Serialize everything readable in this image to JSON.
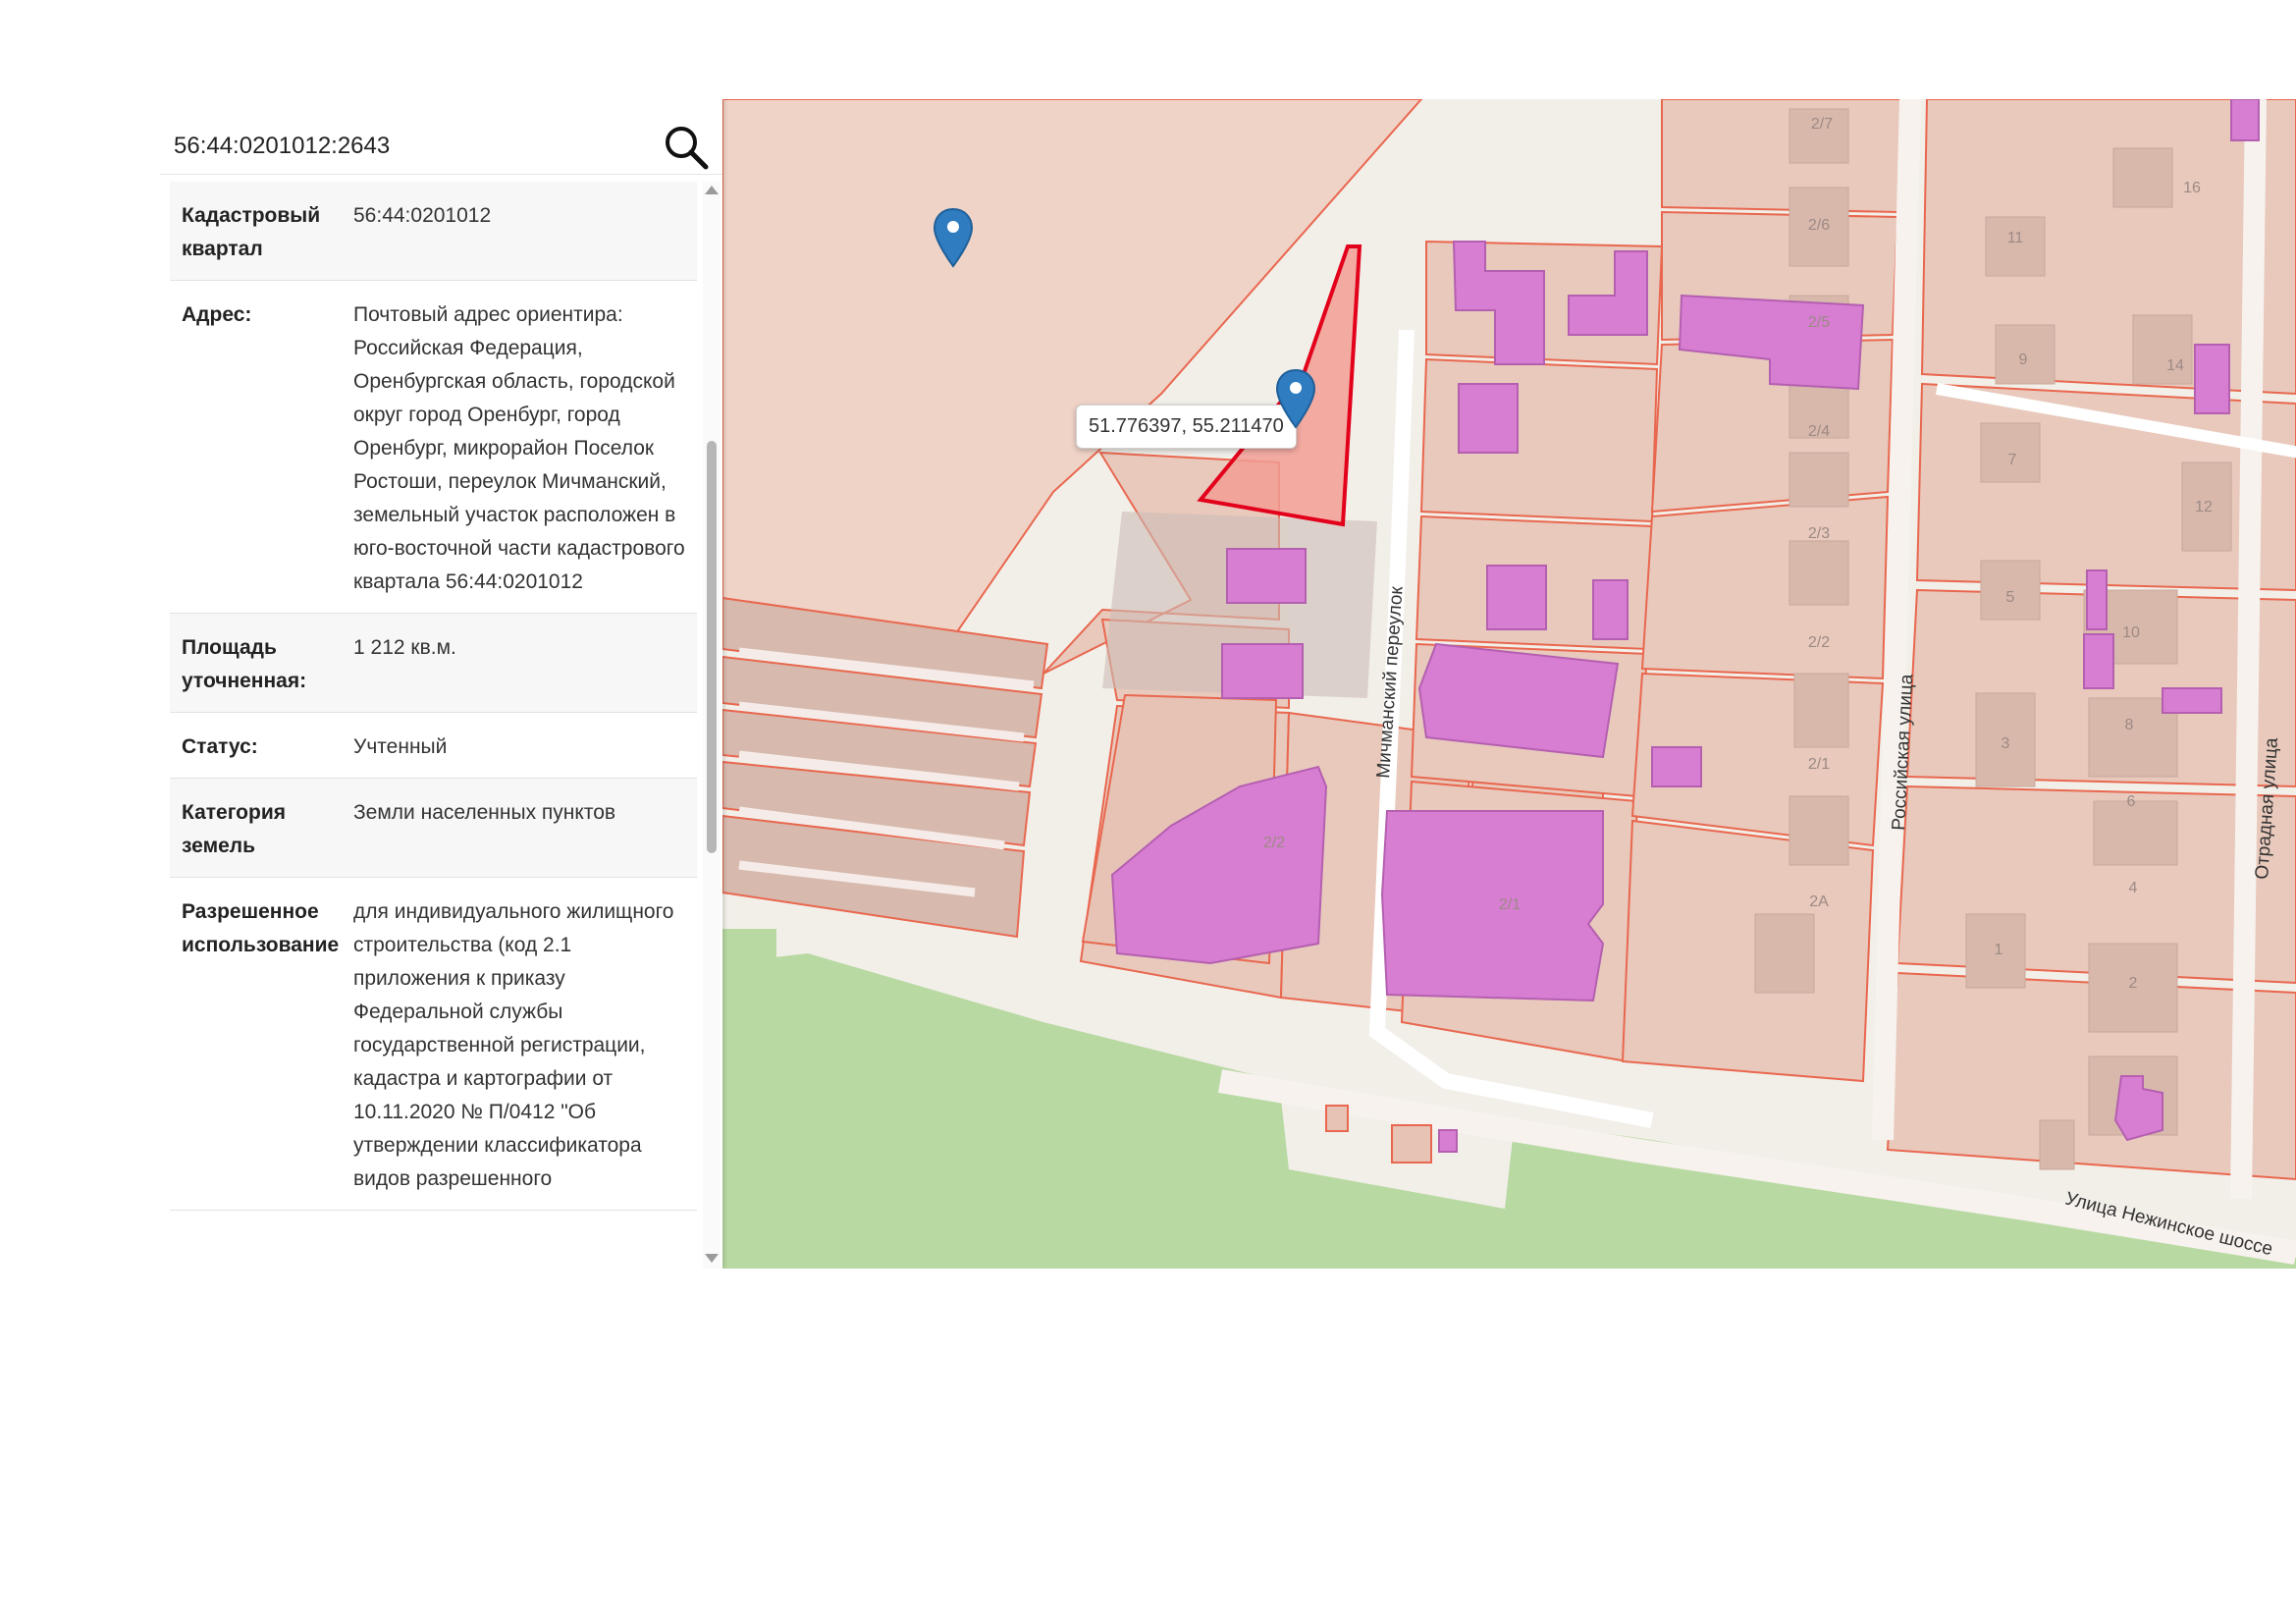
{
  "search": {
    "value": "56:44:0201012:2643",
    "button_icon": "search-icon"
  },
  "info_panel": {
    "rows": [
      {
        "label": "Кадастровый квартал",
        "value": "56:44:0201012"
      },
      {
        "label": "Адрес:",
        "value": "Почтовый адрес ориентира: Российская Федерация, Оренбургская область, городской округ город Оренбург, город Оренбург, микрорайон Поселок Ростоши, переулок Мичманский, земельный участок расположен в юго-восточной части кадастрового квартала 56:44:0201012"
      },
      {
        "label": "Площадь уточненная:",
        "value": "1 212 кв.м."
      },
      {
        "label": "Статус:",
        "value": "Учтенный"
      },
      {
        "label": "Категория земель",
        "value": "Земли населенных пунктов"
      },
      {
        "label": "Разрешенное использование",
        "value": "для индивидуального жилищного строительства (код 2.1 приложения к приказу Федеральной службы государственной регистрации, кадастра и картографии от 10.11.2020 № П/0412 \"Об утверждении классификатора видов разрешенного"
      }
    ]
  },
  "map": {
    "coordinate_popup": "51.776397, 55.211470",
    "streets": {
      "michmansky": "Мичманский переулок",
      "rossiyskaya": "Российская улица",
      "otradnaya": "Отрадная улица",
      "nezhinskoe": "Улица Нежинское шоссе"
    },
    "house_numbers": [
      "2/7",
      "2/6",
      "2/5",
      "2/4",
      "2/3",
      "2/2",
      "2/1",
      "2А",
      "2/2",
      "2/1",
      "16",
      "11",
      "14",
      "9",
      "7",
      "12",
      "5",
      "10",
      "8",
      "3",
      "6",
      "4",
      "1",
      "2"
    ],
    "colors": {
      "parcel_fill": "#e8c9bc",
      "parcel_stroke": "#e9674f",
      "building": "#d77ed2",
      "selected_parcel": "#e3001b",
      "park": "#b9d9a3",
      "marker": "#2f7cc0"
    },
    "marker_icons": [
      "map-marker-icon",
      "map-marker-icon"
    ]
  }
}
